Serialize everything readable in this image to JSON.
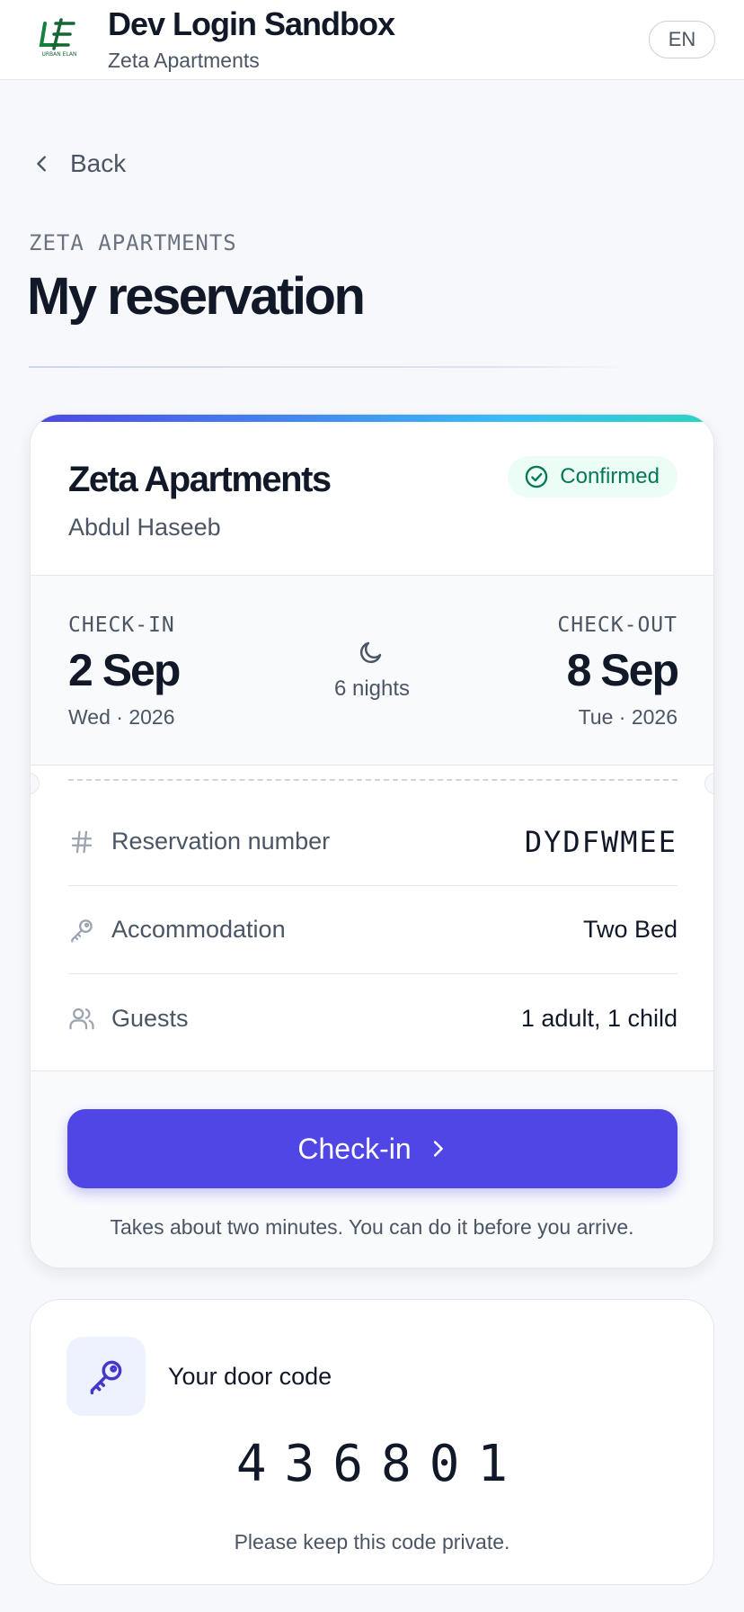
{
  "header": {
    "logo": "urban-elan-logo",
    "logo_caption": "URBAN ELAN",
    "app_title": "Dev Login Sandbox",
    "property_name": "Zeta Apartments",
    "language": "EN"
  },
  "nav": {
    "back_label": "Back"
  },
  "page": {
    "eyebrow": "ZETA APARTMENTS",
    "title": "My reservation"
  },
  "reservation": {
    "property": "Zeta Apartments",
    "guest": "Abdul Haseeb",
    "status": "Confirmed",
    "check_in": {
      "label": "CHECK-IN",
      "date": "2 Sep",
      "sub": "Wed · 2026"
    },
    "nights": "6 nights",
    "check_out": {
      "label": "CHECK-OUT",
      "date": "8 Sep",
      "sub": "Tue · 2026"
    },
    "details": [
      {
        "label": "Reservation number",
        "value": "DYDFWMEE",
        "icon": "hash-icon"
      },
      {
        "label": "Accommodation",
        "value": "Two Bed",
        "icon": "key-icon"
      },
      {
        "label": "Guests",
        "value": "1 adult, 1 child",
        "icon": "users-icon"
      }
    ],
    "cta_label": "Check-in",
    "cta_hint": "Takes about two minutes. You can do it before you arrive."
  },
  "door": {
    "title": "Your door code",
    "code": "436801",
    "note": "Please keep this code private."
  },
  "colors": {
    "primary": "#4f46e5",
    "success_text": "#047857",
    "success_bg": "#ecfdf5",
    "background": "#f7f8fb"
  }
}
